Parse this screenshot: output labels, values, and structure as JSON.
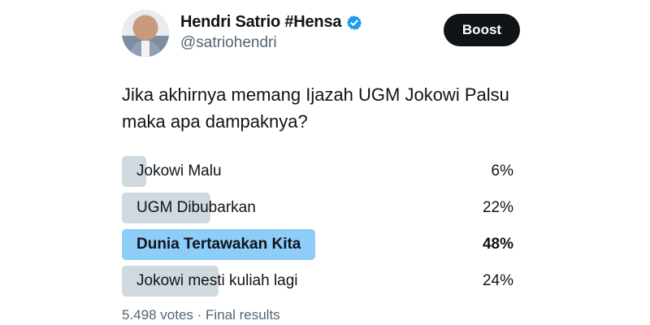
{
  "author": {
    "display_name": "Hendri Satrio #Hensa",
    "handle": "@satriohendri",
    "verified": true,
    "verified_color": "#1d9bf0"
  },
  "boost_label": "Boost",
  "question": "Jika akhirnya memang Ijazah UGM Jokowi Palsu maka apa dampaknya?",
  "poll": {
    "options": [
      {
        "label": "Jokowi Malu",
        "percent": "6%",
        "value": 6,
        "winner": false
      },
      {
        "label": "UGM Dibubarkan",
        "percent": "22%",
        "value": 22,
        "winner": false
      },
      {
        "label": "Dunia Tertawakan Kita",
        "percent": "48%",
        "value": 48,
        "winner": true
      },
      {
        "label": "Jokowi mesti kuliah lagi",
        "percent": "24%",
        "value": 24,
        "winner": false
      }
    ],
    "votes": "5.498 votes",
    "status": "Final results",
    "winner_color": "#8ecdf7",
    "bar_color": "#cfd9de"
  }
}
